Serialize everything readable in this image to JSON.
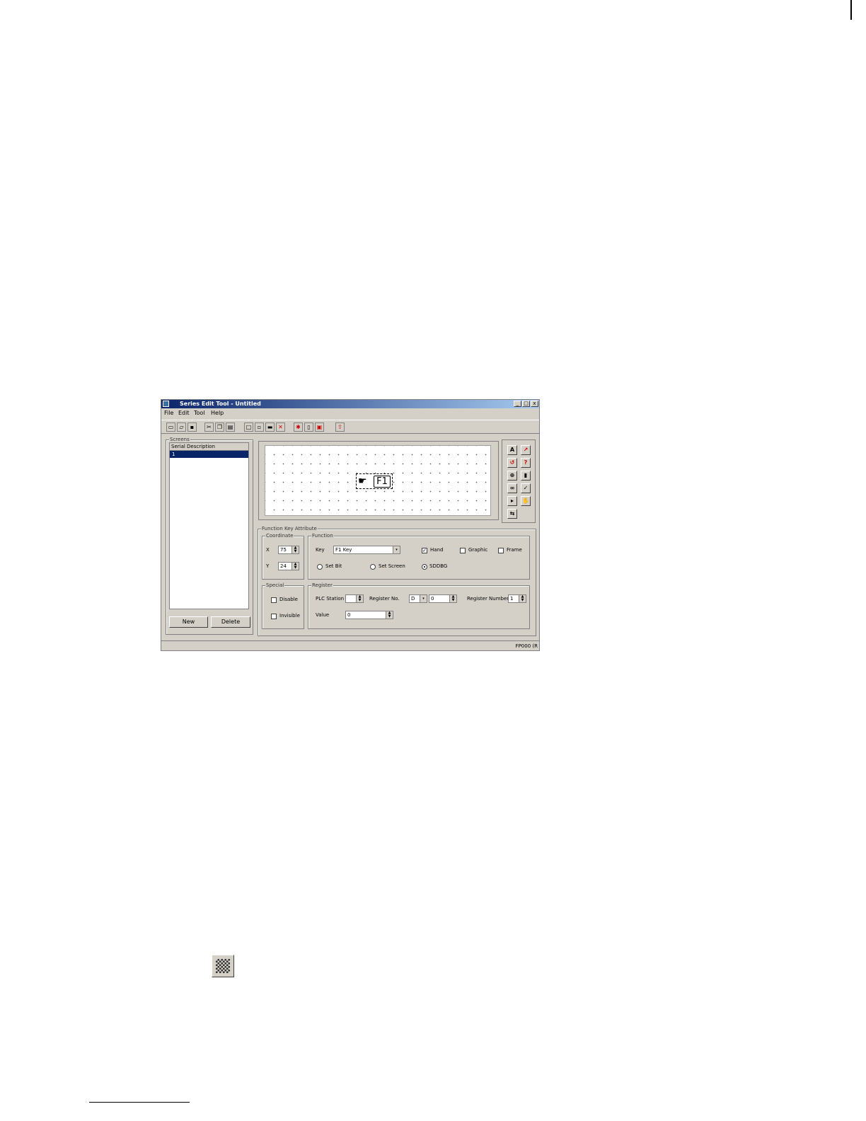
{
  "window": {
    "title": "Series Edit Tool - Untitled",
    "controls": {
      "minimize": "_",
      "maximize": "□",
      "close": "x"
    }
  },
  "menu": [
    "File",
    "Edit",
    "Tool",
    "Help"
  ],
  "toolbar": {
    "buttons": [
      "new-icon",
      "open-icon",
      "save-icon",
      "cut-icon",
      "copy-icon",
      "paste-icon",
      "add-screen-icon",
      "screen-edit-icon",
      "screen-copy-icon",
      "delete-icon",
      "settings-icon",
      "page-icon",
      "page2-icon",
      "exit-icon"
    ]
  },
  "screens": {
    "group_label": "Screens",
    "column_header": "Serial Description",
    "rows": [
      "1"
    ],
    "new_label": "New",
    "delete_label": "Delete"
  },
  "canvas": {
    "fkey_label": "F1"
  },
  "palette": {
    "tools": [
      "A",
      "↗",
      "↺",
      "?",
      "⊕",
      "▮",
      "∞",
      "✓",
      "▸",
      "✋",
      "⇆"
    ]
  },
  "attributes": {
    "group_label": "Function Key Attribute",
    "coordinate": {
      "label": "Coordinate",
      "x_label": "X",
      "x_value": "75",
      "y_label": "Y",
      "y_value": "24"
    },
    "function": {
      "label": "Function",
      "key_label": "Key",
      "key_value": "F1 Key",
      "hand_label": "Hand",
      "hand_checked": true,
      "graphic_label": "Graphic",
      "frame_label": "Frame",
      "set_bit_label": "Set Bit",
      "set_screen_label": "Set Screen",
      "set_ddbg_label": "SDDBG"
    },
    "special": {
      "label": "Special",
      "disable_label": "Disable",
      "invisible_label": "Invisible"
    },
    "register": {
      "label": "Register",
      "plc_station_label": "PLC Station",
      "register_no_label": "Register No.",
      "register_type": "D",
      "register_no_value": "0",
      "register_number_label": "Register Number",
      "register_number_value": "1",
      "value_label": "Value",
      "value": "0"
    }
  },
  "status": {
    "text": "FP000 (R"
  }
}
